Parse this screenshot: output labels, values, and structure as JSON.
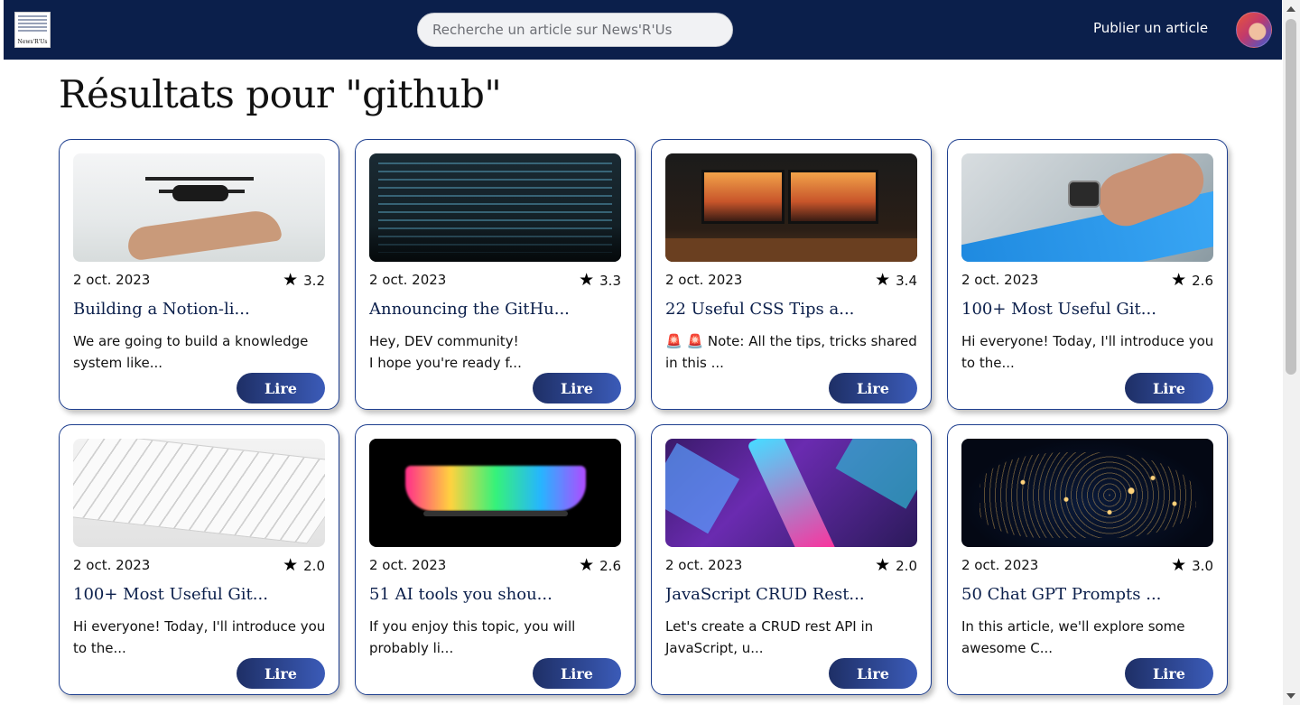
{
  "header": {
    "logo_text": "News'R'Us",
    "search_placeholder": "Recherche un article sur News'R'Us",
    "publish_label": "Publier un article"
  },
  "page": {
    "title": "Résultats pour \"github\""
  },
  "cards": [
    {
      "date": "2 oct. 2023",
      "rating": "3.2",
      "title": "Building a Notion-li...",
      "excerpt": "We are going to build a knowledge system like...",
      "button": "Lire",
      "image": "drone"
    },
    {
      "date": "2 oct. 2023",
      "rating": "3.3",
      "title": "Announcing the GitHu...",
      "excerpt": "Hey, DEV community!\nI hope you're ready f...",
      "button": "Lire",
      "image": "code"
    },
    {
      "date": "2 oct. 2023",
      "rating": "3.4",
      "title": "22 Useful CSS Tips a...",
      "excerpt": "🚨 🚨 Note: All the tips, tricks shared in this ...",
      "button": "Lire",
      "image": "desk"
    },
    {
      "date": "2 oct. 2023",
      "rating": "2.6",
      "title": "100+ Most Useful Git...",
      "excerpt": "Hi everyone! Today, I'll introduce you to the...",
      "button": "Lire",
      "image": "watch"
    },
    {
      "date": "2 oct. 2023",
      "rating": "2.0",
      "title": "100+ Most Useful Git...",
      "excerpt": "Hi everyone! Today, I'll introduce you to the...",
      "button": "Lire",
      "image": "keyboard"
    },
    {
      "date": "2 oct. 2023",
      "rating": "2.6",
      "title": "51 AI tools you shou...",
      "excerpt": "If you enjoy this topic, you will probably li...",
      "button": "Lire",
      "image": "laptop"
    },
    {
      "date": "2 oct. 2023",
      "rating": "2.0",
      "title": "JavaScript CRUD Rest...",
      "excerpt": "Let's create a CRUD rest API in JavaScript, u...",
      "button": "Lire",
      "image": "tube"
    },
    {
      "date": "2 oct. 2023",
      "rating": "3.0",
      "title": "50 Chat GPT Prompts ...",
      "excerpt": "In this article, we'll explore some awesome C...",
      "button": "Lire",
      "image": "map"
    }
  ],
  "colors": {
    "header_bg": "#0b1f4b",
    "card_border": "#1e3f8f",
    "button_gradient_start": "#1e2f66",
    "button_gradient_end": "#3b5bb8"
  },
  "icons": {
    "rating": "star-icon"
  }
}
